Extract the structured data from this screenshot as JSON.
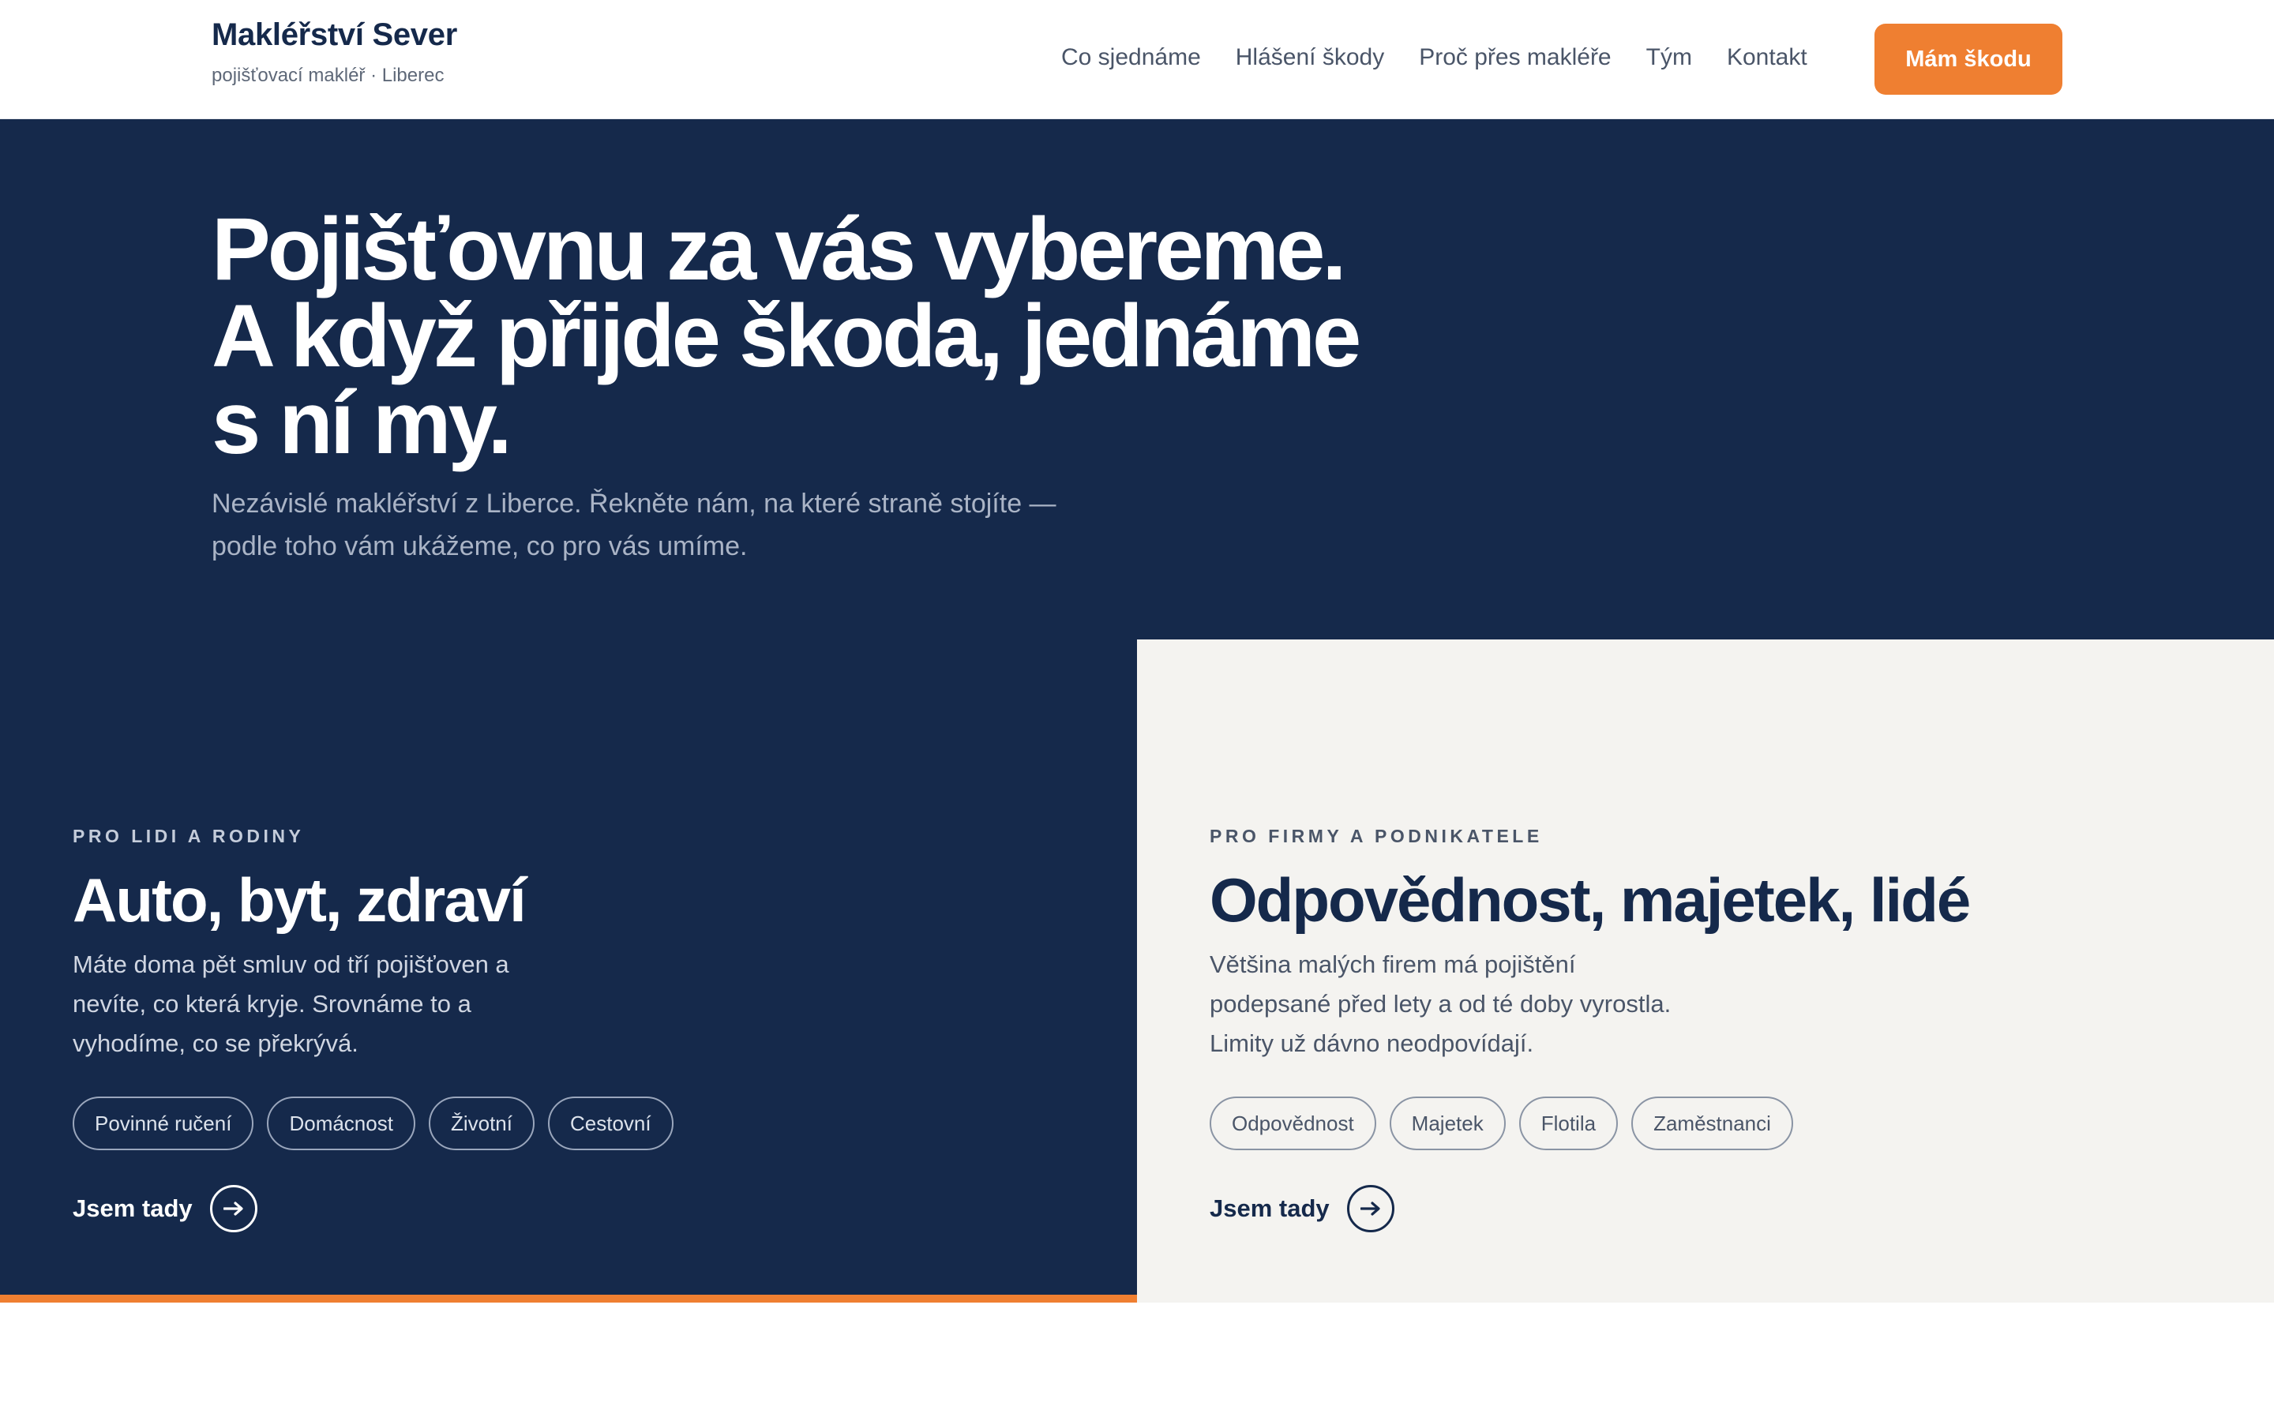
{
  "brand": {
    "name": "Makléřství Sever",
    "tagline": "pojišťovací makléř · Liberec"
  },
  "nav": {
    "items": [
      "Co sjednáme",
      "Hlášení škody",
      "Proč přes makléře",
      "Tým",
      "Kontakt"
    ],
    "cta_label": "Mám škodu"
  },
  "hero": {
    "title_lines": [
      "Pojišťovnu za vás vybereme.",
      "A když přijde škoda, jednáme",
      "s ní my."
    ],
    "subtitle": "Nezávislé makléřství z Liberce. Řekněte nám, na které straně stojíte — podle toho vám ukážeme, co pro vás umíme."
  },
  "cards": [
    {
      "eyebrow": "PRO LIDI A RODINY",
      "title": "Auto, byt, zdraví",
      "description": "Máte doma pět smluv od tří pojišťoven a nevíte, co která kryje. Srovnáme to a vyhodíme, co se překrývá.",
      "tags": [
        "Povinné ručení",
        "Domácnost",
        "Životní",
        "Cestovní"
      ],
      "link_label": "Jsem tady"
    },
    {
      "eyebrow": "PRO FIRMY A PODNIKATELE",
      "title": "Odpovědnost, majetek, lidé",
      "description": "Většina malých firem má pojištění podepsané před lety a od té doby vyrostla. Limity už dávno neodpovídají.",
      "tags": [
        "Odpovědnost",
        "Majetek",
        "Flotila",
        "Zaměstnanci"
      ],
      "link_label": "Jsem tady"
    }
  ],
  "colors": {
    "navy": "#15294b",
    "accent": "#ef7f31",
    "light_panel": "#f4f3f0"
  },
  "icons": {
    "link_arrow": "arrow-right-icon"
  }
}
